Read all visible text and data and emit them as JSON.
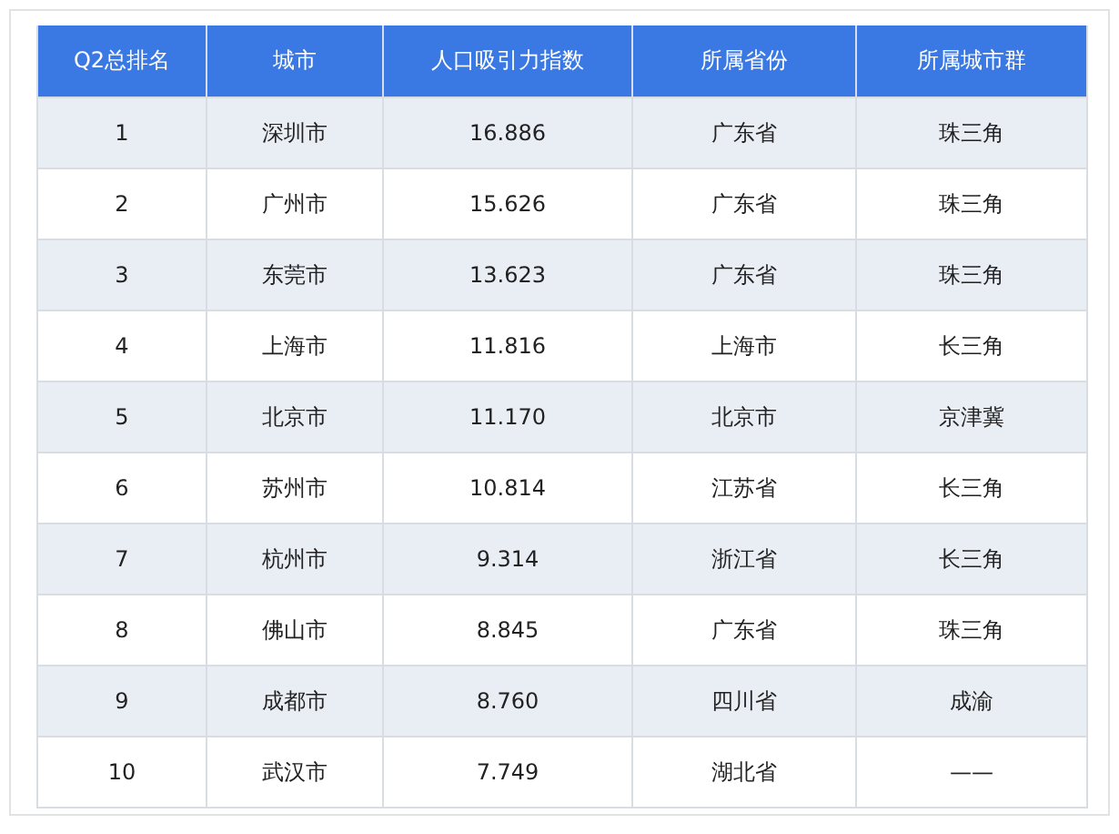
{
  "table": {
    "columns": [
      "Q2总排名",
      "城市",
      "人口吸引力指数",
      "所属省份",
      "所属城市群"
    ],
    "rows": [
      [
        "1",
        "深圳市",
        "16.886",
        "广东省",
        "珠三角"
      ],
      [
        "2",
        "广州市",
        "15.626",
        "广东省",
        "珠三角"
      ],
      [
        "3",
        "东莞市",
        "13.623",
        "广东省",
        "珠三角"
      ],
      [
        "4",
        "上海市",
        "11.816",
        "上海市",
        "长三角"
      ],
      [
        "5",
        "北京市",
        "11.170",
        "北京市",
        "京津冀"
      ],
      [
        "6",
        "苏州市",
        "10.814",
        "江苏省",
        "长三角"
      ],
      [
        "7",
        "杭州市",
        "9.314",
        "浙江省",
        "长三角"
      ],
      [
        "8",
        "佛山市",
        "8.845",
        "广东省",
        "珠三角"
      ],
      [
        "9",
        "成都市",
        "8.760",
        "四川省",
        "成渝"
      ],
      [
        "10",
        "武汉市",
        "7.749",
        "湖北省",
        "——"
      ]
    ]
  }
}
